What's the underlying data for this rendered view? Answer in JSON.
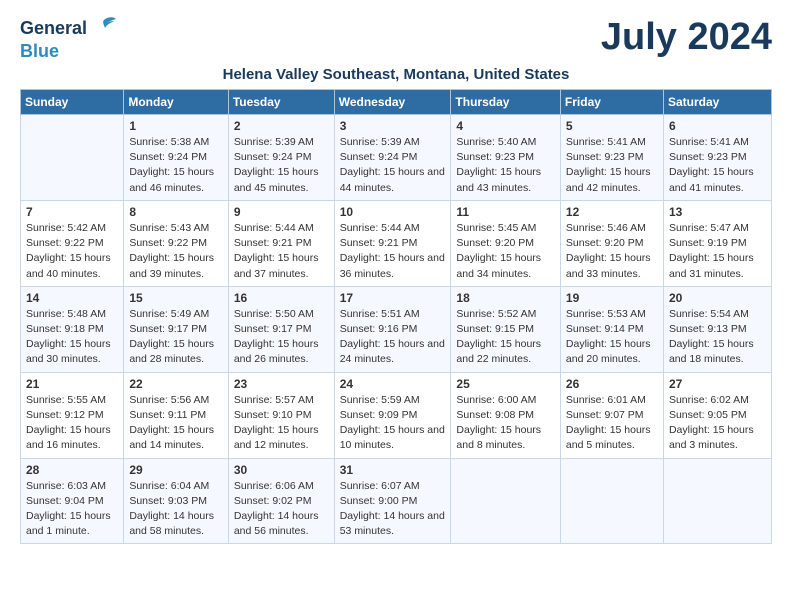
{
  "header": {
    "logo_general": "General",
    "logo_blue": "Blue",
    "month_year": "July 2024",
    "location": "Helena Valley Southeast, Montana, United States"
  },
  "columns": [
    "Sunday",
    "Monday",
    "Tuesday",
    "Wednesday",
    "Thursday",
    "Friday",
    "Saturday"
  ],
  "weeks": [
    [
      {
        "day": "",
        "sunrise": "",
        "sunset": "",
        "daylight": ""
      },
      {
        "day": "1",
        "sunrise": "Sunrise: 5:38 AM",
        "sunset": "Sunset: 9:24 PM",
        "daylight": "Daylight: 15 hours and 46 minutes."
      },
      {
        "day": "2",
        "sunrise": "Sunrise: 5:39 AM",
        "sunset": "Sunset: 9:24 PM",
        "daylight": "Daylight: 15 hours and 45 minutes."
      },
      {
        "day": "3",
        "sunrise": "Sunrise: 5:39 AM",
        "sunset": "Sunset: 9:24 PM",
        "daylight": "Daylight: 15 hours and 44 minutes."
      },
      {
        "day": "4",
        "sunrise": "Sunrise: 5:40 AM",
        "sunset": "Sunset: 9:23 PM",
        "daylight": "Daylight: 15 hours and 43 minutes."
      },
      {
        "day": "5",
        "sunrise": "Sunrise: 5:41 AM",
        "sunset": "Sunset: 9:23 PM",
        "daylight": "Daylight: 15 hours and 42 minutes."
      },
      {
        "day": "6",
        "sunrise": "Sunrise: 5:41 AM",
        "sunset": "Sunset: 9:23 PM",
        "daylight": "Daylight: 15 hours and 41 minutes."
      }
    ],
    [
      {
        "day": "7",
        "sunrise": "Sunrise: 5:42 AM",
        "sunset": "Sunset: 9:22 PM",
        "daylight": "Daylight: 15 hours and 40 minutes."
      },
      {
        "day": "8",
        "sunrise": "Sunrise: 5:43 AM",
        "sunset": "Sunset: 9:22 PM",
        "daylight": "Daylight: 15 hours and 39 minutes."
      },
      {
        "day": "9",
        "sunrise": "Sunrise: 5:44 AM",
        "sunset": "Sunset: 9:21 PM",
        "daylight": "Daylight: 15 hours and 37 minutes."
      },
      {
        "day": "10",
        "sunrise": "Sunrise: 5:44 AM",
        "sunset": "Sunset: 9:21 PM",
        "daylight": "Daylight: 15 hours and 36 minutes."
      },
      {
        "day": "11",
        "sunrise": "Sunrise: 5:45 AM",
        "sunset": "Sunset: 9:20 PM",
        "daylight": "Daylight: 15 hours and 34 minutes."
      },
      {
        "day": "12",
        "sunrise": "Sunrise: 5:46 AM",
        "sunset": "Sunset: 9:20 PM",
        "daylight": "Daylight: 15 hours and 33 minutes."
      },
      {
        "day": "13",
        "sunrise": "Sunrise: 5:47 AM",
        "sunset": "Sunset: 9:19 PM",
        "daylight": "Daylight: 15 hours and 31 minutes."
      }
    ],
    [
      {
        "day": "14",
        "sunrise": "Sunrise: 5:48 AM",
        "sunset": "Sunset: 9:18 PM",
        "daylight": "Daylight: 15 hours and 30 minutes."
      },
      {
        "day": "15",
        "sunrise": "Sunrise: 5:49 AM",
        "sunset": "Sunset: 9:17 PM",
        "daylight": "Daylight: 15 hours and 28 minutes."
      },
      {
        "day": "16",
        "sunrise": "Sunrise: 5:50 AM",
        "sunset": "Sunset: 9:17 PM",
        "daylight": "Daylight: 15 hours and 26 minutes."
      },
      {
        "day": "17",
        "sunrise": "Sunrise: 5:51 AM",
        "sunset": "Sunset: 9:16 PM",
        "daylight": "Daylight: 15 hours and 24 minutes."
      },
      {
        "day": "18",
        "sunrise": "Sunrise: 5:52 AM",
        "sunset": "Sunset: 9:15 PM",
        "daylight": "Daylight: 15 hours and 22 minutes."
      },
      {
        "day": "19",
        "sunrise": "Sunrise: 5:53 AM",
        "sunset": "Sunset: 9:14 PM",
        "daylight": "Daylight: 15 hours and 20 minutes."
      },
      {
        "day": "20",
        "sunrise": "Sunrise: 5:54 AM",
        "sunset": "Sunset: 9:13 PM",
        "daylight": "Daylight: 15 hours and 18 minutes."
      }
    ],
    [
      {
        "day": "21",
        "sunrise": "Sunrise: 5:55 AM",
        "sunset": "Sunset: 9:12 PM",
        "daylight": "Daylight: 15 hours and 16 minutes."
      },
      {
        "day": "22",
        "sunrise": "Sunrise: 5:56 AM",
        "sunset": "Sunset: 9:11 PM",
        "daylight": "Daylight: 15 hours and 14 minutes."
      },
      {
        "day": "23",
        "sunrise": "Sunrise: 5:57 AM",
        "sunset": "Sunset: 9:10 PM",
        "daylight": "Daylight: 15 hours and 12 minutes."
      },
      {
        "day": "24",
        "sunrise": "Sunrise: 5:59 AM",
        "sunset": "Sunset: 9:09 PM",
        "daylight": "Daylight: 15 hours and 10 minutes."
      },
      {
        "day": "25",
        "sunrise": "Sunrise: 6:00 AM",
        "sunset": "Sunset: 9:08 PM",
        "daylight": "Daylight: 15 hours and 8 minutes."
      },
      {
        "day": "26",
        "sunrise": "Sunrise: 6:01 AM",
        "sunset": "Sunset: 9:07 PM",
        "daylight": "Daylight: 15 hours and 5 minutes."
      },
      {
        "day": "27",
        "sunrise": "Sunrise: 6:02 AM",
        "sunset": "Sunset: 9:05 PM",
        "daylight": "Daylight: 15 hours and 3 minutes."
      }
    ],
    [
      {
        "day": "28",
        "sunrise": "Sunrise: 6:03 AM",
        "sunset": "Sunset: 9:04 PM",
        "daylight": "Daylight: 15 hours and 1 minute."
      },
      {
        "day": "29",
        "sunrise": "Sunrise: 6:04 AM",
        "sunset": "Sunset: 9:03 PM",
        "daylight": "Daylight: 14 hours and 58 minutes."
      },
      {
        "day": "30",
        "sunrise": "Sunrise: 6:06 AM",
        "sunset": "Sunset: 9:02 PM",
        "daylight": "Daylight: 14 hours and 56 minutes."
      },
      {
        "day": "31",
        "sunrise": "Sunrise: 6:07 AM",
        "sunset": "Sunset: 9:00 PM",
        "daylight": "Daylight: 14 hours and 53 minutes."
      },
      {
        "day": "",
        "sunrise": "",
        "sunset": "",
        "daylight": ""
      },
      {
        "day": "",
        "sunrise": "",
        "sunset": "",
        "daylight": ""
      },
      {
        "day": "",
        "sunrise": "",
        "sunset": "",
        "daylight": ""
      }
    ]
  ]
}
